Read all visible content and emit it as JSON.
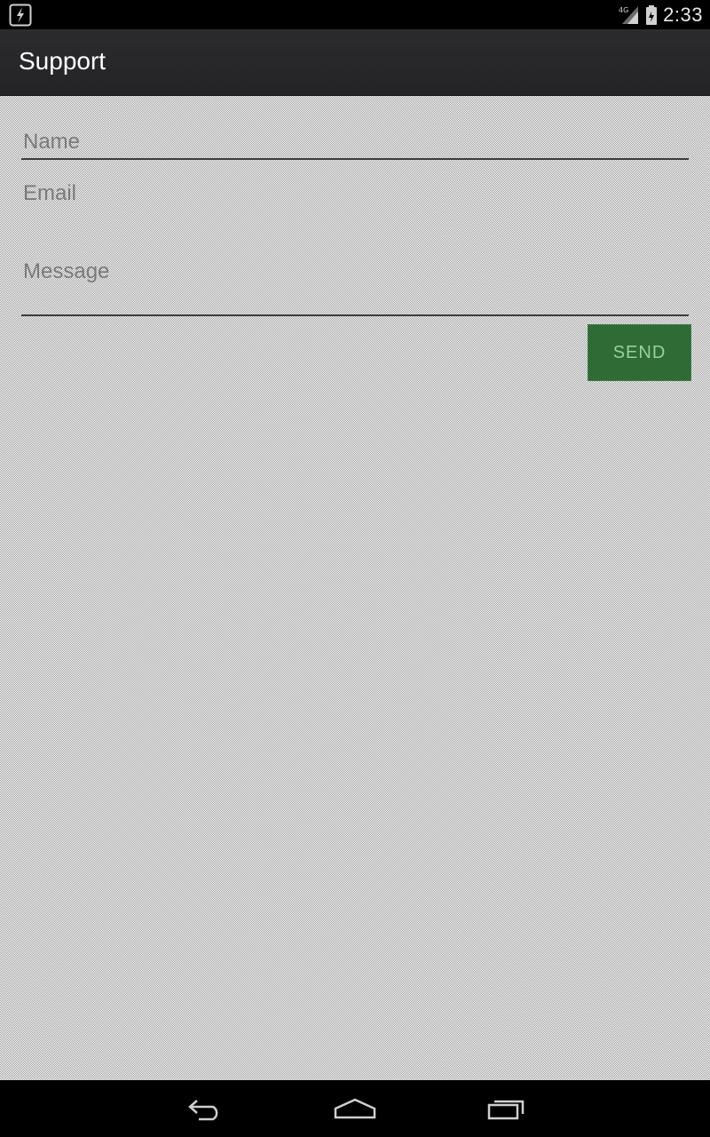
{
  "status_bar": {
    "time": "2:33",
    "left_icon": "flash-icon",
    "network_icon": "signal-4g-icon",
    "battery_icon": "battery-icon"
  },
  "action_bar": {
    "title": "Support"
  },
  "form": {
    "name": {
      "placeholder": "Name",
      "value": ""
    },
    "email": {
      "placeholder": "Email",
      "value": ""
    },
    "message": {
      "placeholder": "Message",
      "value": ""
    },
    "send_label": "SEND"
  },
  "nav_bar": {
    "back_icon": "back-icon",
    "home_icon": "home-icon",
    "recent_icon": "recent-apps-icon"
  },
  "colors": {
    "status_bar": "#000000",
    "action_bar": "#2b2b2d",
    "send_button": "#2e6b35",
    "hint_text": "#7a7a7a"
  }
}
